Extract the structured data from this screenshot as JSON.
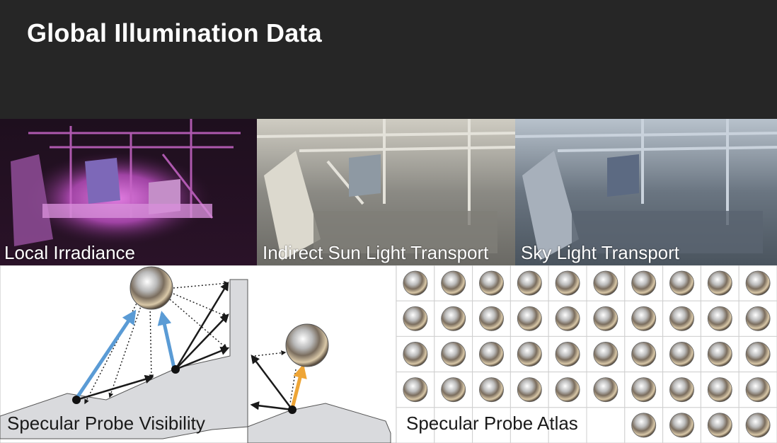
{
  "header": {
    "title": "Global Illumination Data"
  },
  "panels": [
    {
      "label": "Local Irradiance"
    },
    {
      "label": "Indirect Sun Light Transport"
    },
    {
      "label": "Sky Light Transport"
    }
  ],
  "diagram": {
    "label": "Specular Probe Visibility"
  },
  "atlas": {
    "label": "Specular Probe Atlas",
    "columns": 10,
    "rows": 5,
    "empty_cells_last_row": 6
  },
  "colors": {
    "header_bg": "#262626",
    "blue_ray": "#5a9bd5",
    "orange_ray": "#eea536",
    "ground": "#d9dadd"
  }
}
